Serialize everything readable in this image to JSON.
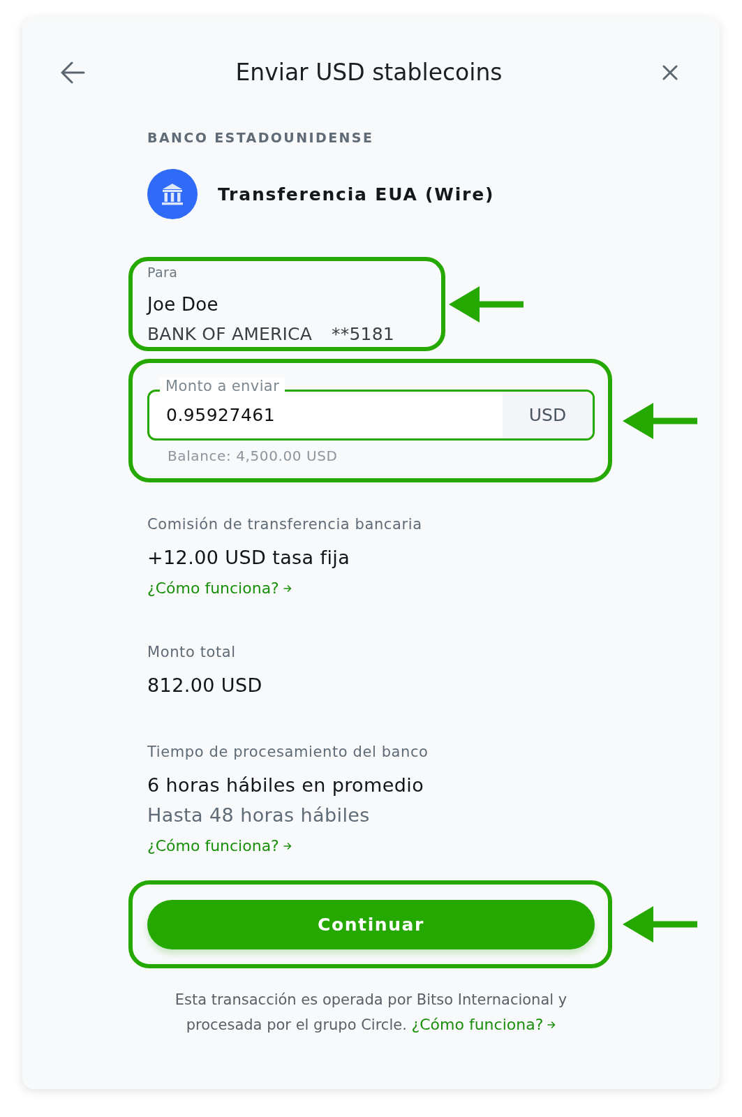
{
  "header": {
    "title": "Enviar USD stablecoins"
  },
  "method": {
    "section_label": "BANCO ESTADOUNIDENSE",
    "name": "Transferencia EUA (Wire)"
  },
  "recipient": {
    "label": "Para",
    "name": "Joe Doe",
    "bank": "BANK OF AMERICA",
    "account": "**5181",
    "highlighted": true
  },
  "amount": {
    "label": "Monto a enviar",
    "value": "0.95927461",
    "currency": "USD",
    "balance": "Balance: 4,500.00 USD",
    "highlighted": true
  },
  "details": [
    {
      "label": "Comisión de transferencia bancaria",
      "lines": [
        {
          "kind": "primary",
          "text": "+12.00 USD tasa fija"
        }
      ],
      "link": "¿Cómo funciona?"
    },
    {
      "label": "Monto total",
      "lines": [
        {
          "kind": "primary",
          "text": "812.00 USD"
        }
      ]
    },
    {
      "label": "Tiempo de procesamiento del banco",
      "lines": [
        {
          "kind": "primary",
          "text": "6 horas hábiles en promedio"
        },
        {
          "kind": "secondary",
          "text": "Hasta 48 horas hábiles"
        }
      ],
      "link": "¿Cómo funciona?"
    }
  ],
  "continue_button": {
    "label": "Continuar",
    "highlighted": true
  },
  "footer": {
    "text": "Esta transacción es operada por Bitso Internacional y procesada por el grupo Circle.",
    "link": "¿Cómo funciona?"
  }
}
